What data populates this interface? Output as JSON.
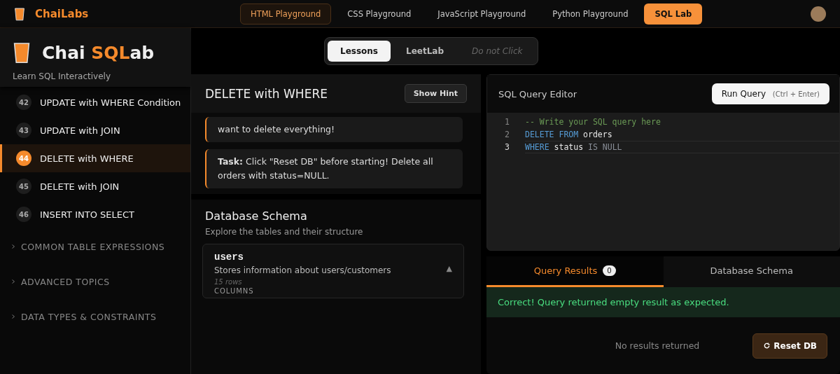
{
  "brand": {
    "name": "ChaiLabs"
  },
  "nav": [
    {
      "label": "HTML Playground",
      "selected": false,
      "outlined": true
    },
    {
      "label": "CSS Playground",
      "selected": false,
      "outlined": false
    },
    {
      "label": "JavaScript Playground",
      "selected": false,
      "outlined": false
    },
    {
      "label": "Python Playground",
      "selected": false,
      "outlined": false
    },
    {
      "label": "SQL Lab",
      "selected": true,
      "outlined": false
    }
  ],
  "sidebar": {
    "title_plain": "Chai ",
    "title_accent": "SQL",
    "title_rest": "ab",
    "subtitle": "Learn SQL Interactively",
    "lessons": [
      {
        "number": "42",
        "label": "UPDATE with WHERE Condition",
        "selected": false
      },
      {
        "number": "43",
        "label": "UPDATE with JOIN",
        "selected": false
      },
      {
        "number": "44",
        "label": "DELETE with WHERE",
        "selected": true
      },
      {
        "number": "45",
        "label": "DELETE with JOIN",
        "selected": false
      },
      {
        "number": "46",
        "label": "INSERT INTO SELECT",
        "selected": false
      }
    ],
    "sections": [
      {
        "label": "COMMON TABLE EXPRESSIONS",
        "expanded": false
      },
      {
        "label": "ADVANCED TOPICS",
        "expanded": false
      },
      {
        "label": "DATA TYPES & CONSTRAINTS",
        "expanded": false
      }
    ]
  },
  "mode_tabs": [
    {
      "label": "Lessons",
      "selected": true,
      "disabled": false
    },
    {
      "label": "LeetLab",
      "selected": false,
      "disabled": false
    },
    {
      "label": "Do not Click",
      "selected": false,
      "disabled": true
    }
  ],
  "lesson": {
    "title": "DELETE with WHERE",
    "hint_button": "Show Hint",
    "notes": [
      {
        "text": "want to delete everything!"
      },
      {
        "text": "**Task:** Click \"Reset DB\" before starting! Delete all orders with status=NULL."
      }
    ]
  },
  "schema": {
    "title": "Database Schema",
    "subtitle": "Explore the tables and their structure",
    "tables": [
      {
        "name": "users",
        "description": "Stores information about users/customers",
        "rows": "15 rows",
        "expanded": true,
        "toggle": "▲",
        "section": "COLUMNS"
      }
    ]
  },
  "editor": {
    "title": "SQL Query Editor",
    "run_button": "Run Query",
    "shortcut": "(Ctrl + Enter)",
    "lines": [
      {
        "number": "1",
        "current": false,
        "tokens": [
          {
            "kind": "comment",
            "text": "-- Write your SQL query here"
          }
        ]
      },
      {
        "number": "2",
        "current": false,
        "tokens": [
          {
            "kind": "keyword",
            "text": "DELETE FROM"
          },
          {
            "kind": "ident",
            "text": "orders"
          }
        ]
      },
      {
        "number": "3",
        "current": true,
        "tokens": [
          {
            "kind": "keyword",
            "text": "WHERE"
          },
          {
            "kind": "ident",
            "text": "status"
          },
          {
            "kind": "operator",
            "text": "IS NULL"
          }
        ]
      }
    ]
  },
  "results": {
    "tabs": [
      {
        "label": "Query Results",
        "count": "0",
        "selected": true
      },
      {
        "label": "Database Schema",
        "selected": false
      }
    ],
    "message": "Correct! Query returned empty result as expected.",
    "empty": "No results returned",
    "reset_button": "Reset DB"
  }
}
